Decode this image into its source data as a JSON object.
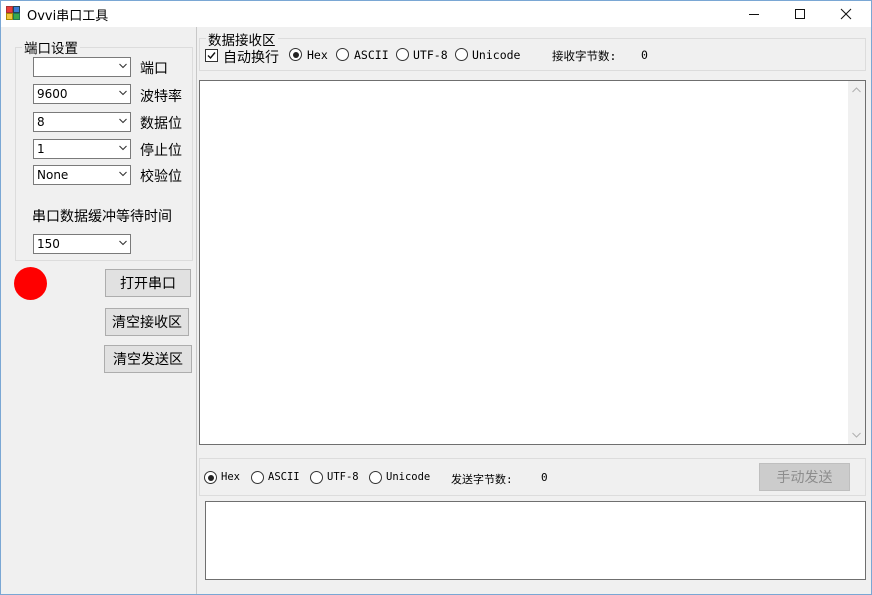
{
  "window": {
    "title": "Ovvi串口工具"
  },
  "left": {
    "port_group_title": "端口设置",
    "fields": [
      {
        "value": "",
        "label": "端口"
      },
      {
        "value": "9600",
        "label": "波特率"
      },
      {
        "value": "8",
        "label": "数据位"
      },
      {
        "value": "1",
        "label": "停止位"
      },
      {
        "value": "None",
        "label": "校验位"
      }
    ],
    "buffer_label": "串口数据缓冲等待时间",
    "buffer_value": "150",
    "status_color": "#ff0000",
    "buttons": {
      "open": "打开串口",
      "clear_receive": "清空接收区",
      "clear_send": "清空发送区"
    }
  },
  "receive": {
    "group_title": "数据接收区",
    "auto_wrap_label": "自动换行",
    "auto_wrap_checked": true,
    "encodings": [
      {
        "label": "Hex",
        "checked": true
      },
      {
        "label": "ASCII",
        "checked": false
      },
      {
        "label": "UTF-8",
        "checked": false
      },
      {
        "label": "Unicode",
        "checked": false
      }
    ],
    "byte_count_label": "接收字节数:",
    "byte_count": "0",
    "content": ""
  },
  "send": {
    "encodings": [
      {
        "label": "Hex",
        "checked": true
      },
      {
        "label": "ASCII",
        "checked": false
      },
      {
        "label": "UTF-8",
        "checked": false
      },
      {
        "label": "Unicode",
        "checked": false
      }
    ],
    "byte_count_label": "发送字节数:",
    "byte_count": "0",
    "send_button": "手动发送",
    "content": ""
  }
}
